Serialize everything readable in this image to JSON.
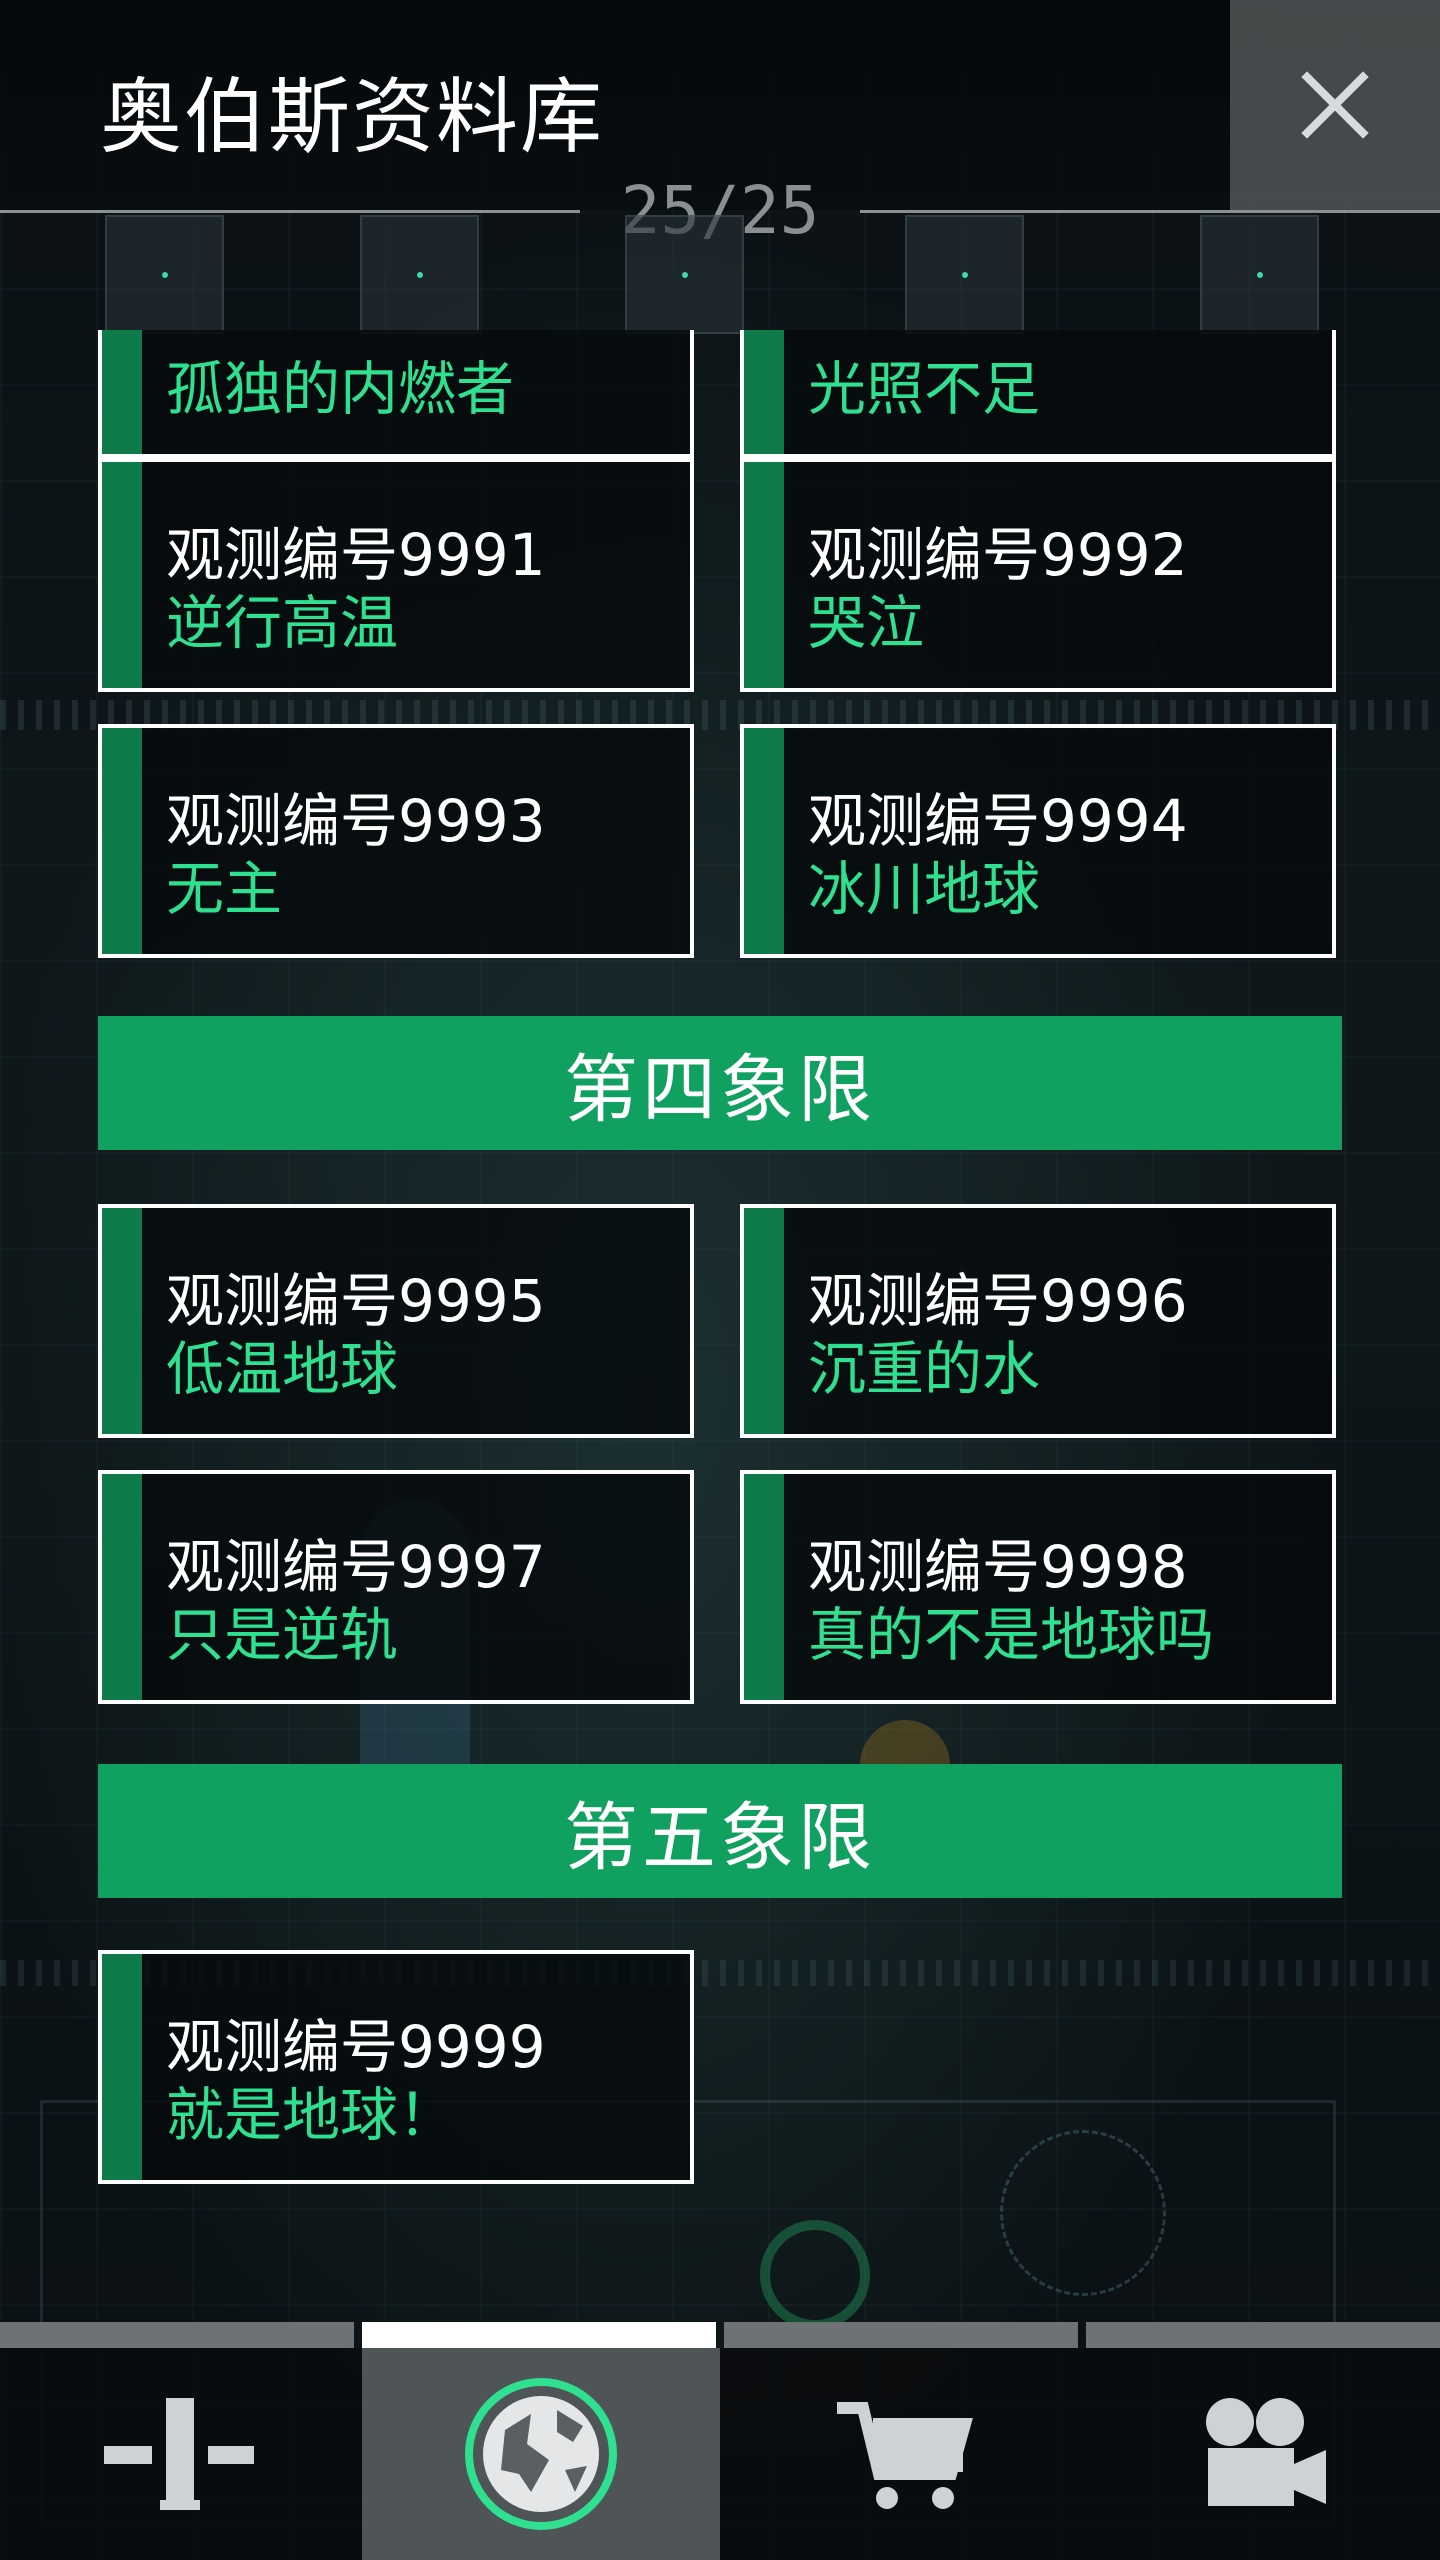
{
  "header": {
    "title": "奥伯斯资料库",
    "page_counter": "25/25",
    "close_icon": "close-icon"
  },
  "observations": [
    {
      "id": "",
      "name": "孤独的内燃者"
    },
    {
      "id": "",
      "name": "光照不足"
    },
    {
      "id": "观测编号9991",
      "name": "逆行高温"
    },
    {
      "id": "观测编号9992",
      "name": "哭泣"
    },
    {
      "id": "观测编号9993",
      "name": "无主"
    },
    {
      "id": "观测编号9994",
      "name": "冰川地球"
    },
    {
      "id": "观测编号9995",
      "name": "低温地球"
    },
    {
      "id": "观测编号9996",
      "name": "沉重的水"
    },
    {
      "id": "观测编号9997",
      "name": "只是逆轨"
    },
    {
      "id": "观测编号9998",
      "name": "真的不是地球吗"
    },
    {
      "id": "观测编号9999",
      "name": "就是地球！"
    }
  ],
  "sections": [
    {
      "label": "第四象限"
    },
    {
      "label": "第五象限"
    }
  ],
  "bottom_nav": {
    "tabs": [
      {
        "icon": "telescope-icon",
        "active": false
      },
      {
        "icon": "planet-icon",
        "active": true
      },
      {
        "icon": "cart-icon",
        "active": false
      },
      {
        "icon": "video-camera-icon",
        "active": false
      }
    ]
  },
  "colors": {
    "accent_green": "#10a060",
    "name_text_green": "#2ee08f",
    "card_bar_green": "#0f7a4a",
    "planet_ring": "#2ee08f"
  }
}
